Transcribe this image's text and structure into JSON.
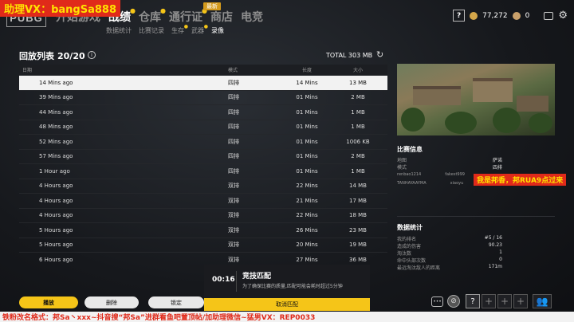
{
  "watermark_top": "助理VX：bangSa888",
  "logo": "PUBG",
  "nav": {
    "tabs": [
      {
        "label": "开始游戏",
        "active": false,
        "star": false
      },
      {
        "label": "战绩",
        "active": true,
        "star": true
      },
      {
        "label": "仓库",
        "active": false,
        "star": true
      },
      {
        "label": "通行证",
        "active": false,
        "star": true
      },
      {
        "label": "商店",
        "active": false,
        "star": false
      },
      {
        "label": "电竞",
        "active": false,
        "star": false
      }
    ],
    "new_badge": "最新",
    "subtabs": [
      {
        "label": "数据统计",
        "active": false,
        "star": false
      },
      {
        "label": "比赛记录",
        "active": false,
        "star": false
      },
      {
        "label": "生存",
        "active": false,
        "star": true
      },
      {
        "label": "武器",
        "active": false,
        "star": true
      },
      {
        "label": "录像",
        "active": true,
        "star": false
      }
    ]
  },
  "topright": {
    "help": "?",
    "bp": "77,272",
    "gcoin": "0"
  },
  "replay": {
    "title": "回放列表",
    "count": "20/20",
    "total": "TOTAL 303 MB",
    "columns": {
      "date": "日期",
      "mode": "模式",
      "length": "长度",
      "size": "大小"
    },
    "rows": [
      {
        "date": "14 Mins ago",
        "mode": "四排",
        "length": "14 Mins",
        "size": "13 MB",
        "selected": true
      },
      {
        "date": "39 Mins ago",
        "mode": "四排",
        "length": "01 Mins",
        "size": "2 MB"
      },
      {
        "date": "44 Mins ago",
        "mode": "四排",
        "length": "01 Mins",
        "size": "1 MB"
      },
      {
        "date": "48 Mins ago",
        "mode": "四排",
        "length": "01 Mins",
        "size": "1 MB"
      },
      {
        "date": "52 Mins ago",
        "mode": "四排",
        "length": "01 Mins",
        "size": "1006 KB"
      },
      {
        "date": "57 Mins ago",
        "mode": "四排",
        "length": "01 Mins",
        "size": "2 MB"
      },
      {
        "date": "1 Hour ago",
        "mode": "四排",
        "length": "01 Mins",
        "size": "1 MB"
      },
      {
        "date": "4 Hours ago",
        "mode": "双排",
        "length": "22 Mins",
        "size": "14 MB"
      },
      {
        "date": "4 Hours ago",
        "mode": "双排",
        "length": "21 Mins",
        "size": "17 MB"
      },
      {
        "date": "4 Hours ago",
        "mode": "双排",
        "length": "22 Mins",
        "size": "18 MB"
      },
      {
        "date": "5 Hours ago",
        "mode": "双排",
        "length": "26 Mins",
        "size": "23 MB"
      },
      {
        "date": "5 Hours ago",
        "mode": "双排",
        "length": "20 Mins",
        "size": "19 MB"
      },
      {
        "date": "6 Hours ago",
        "mode": "双排",
        "length": "27 Mins",
        "size": "36 MB"
      }
    ]
  },
  "match_info": {
    "title": "比赛信息",
    "map_label": "地图",
    "map_value": "萨诺",
    "mode_label": "模式",
    "mode_value": "四排",
    "players": [
      "renbao1214",
      "fakest999",
      "TANHAYAAYMA",
      "xiaoyu"
    ]
  },
  "watermark_side": "我是邦香，邦RUA9点过来",
  "stats": {
    "title": "数据统计",
    "items": [
      {
        "label": "我的排名",
        "value": "#5 / 16"
      },
      {
        "label": "造成的伤害",
        "value": "90.23"
      },
      {
        "label": "淘汰数",
        "value": "1"
      },
      {
        "label": "命中头部次数",
        "value": "0"
      },
      {
        "label": "最远淘汰敌人的距离",
        "value": "171m"
      }
    ]
  },
  "buttons": {
    "play": "播放",
    "delete": "删除",
    "lock": "锁定"
  },
  "matchmaking": {
    "timer": "00:16",
    "title": "竞技匹配",
    "desc": "为了确保比赛的质量,匹配可能会耗时超过5分钟",
    "cancel": "取消匹配"
  },
  "bottom_strip": "铁粉改名格式：邦Sa丶xxx~抖音搜“邦Sa”进群看鱼吧置顶帖/加助理微信~猛男VX：REP0033"
}
